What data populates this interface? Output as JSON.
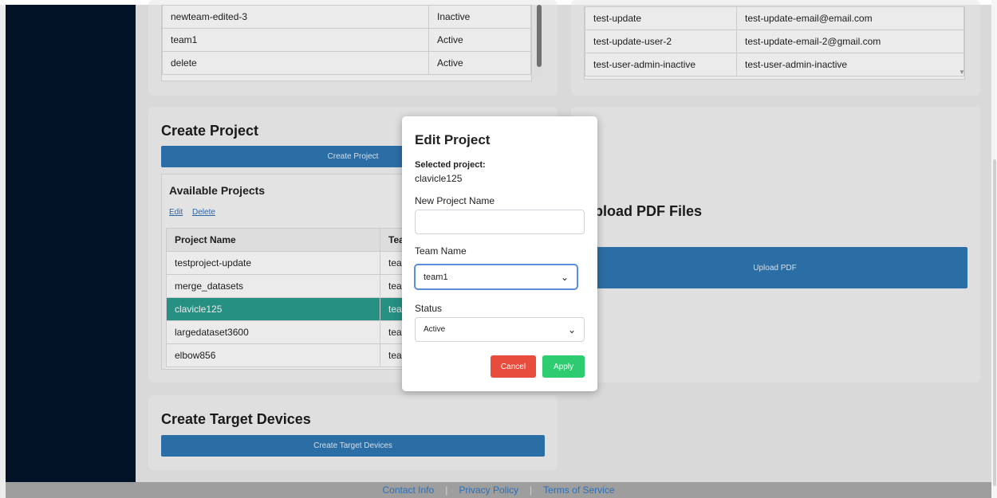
{
  "teams_table": {
    "rows": [
      {
        "name": "newteam-edited-3",
        "status": "Inactive"
      },
      {
        "name": "team1",
        "status": "Active"
      },
      {
        "name": "delete",
        "status": "Active"
      }
    ]
  },
  "users_table": {
    "rows": [
      {
        "user": "test-update",
        "email": "test-update-email@email.com"
      },
      {
        "user": "test-update-user-2",
        "email": "test-update-email-2@gmail.com"
      },
      {
        "user": "test-user-admin-inactive",
        "email": "test-user-admin-inactive"
      }
    ]
  },
  "create_project": {
    "title": "Create Project",
    "button": "Create Project",
    "available_title": "Available Projects",
    "edit_link": "Edit",
    "delete_link": "Delete",
    "col_project": "Project Name",
    "col_team": "Tea",
    "rows": [
      {
        "name": "testproject-update",
        "team": "tea"
      },
      {
        "name": "merge_datasets",
        "team": "tea"
      },
      {
        "name": "clavicle125",
        "team": "tea"
      },
      {
        "name": "largedataset3600",
        "team": "tea"
      },
      {
        "name": "elbow856",
        "team": "tea"
      }
    ]
  },
  "upload": {
    "title": "pload PDF Files",
    "button": "Upload PDF"
  },
  "target": {
    "title": "Create Target Devices",
    "button": "Create Target Devices"
  },
  "modal": {
    "title": "Edit Project",
    "selected_label": "Selected project:",
    "selected_value": "clavicle125",
    "name_label": "New Project Name",
    "name_value": "",
    "team_label": "Team Name",
    "team_value": "team1",
    "status_label": "Status",
    "status_value": "Active",
    "cancel": "Cancel",
    "apply": "Apply"
  },
  "footer": {
    "contact": "Contact Info",
    "privacy": "Privacy Policy",
    "terms": "Terms of Service"
  },
  "colors": {
    "sidebar": "#02142b",
    "primary": "#2f78b4",
    "selected_row": "#2a9d8f",
    "cancel": "#e74c3c",
    "apply": "#2ecc71"
  }
}
